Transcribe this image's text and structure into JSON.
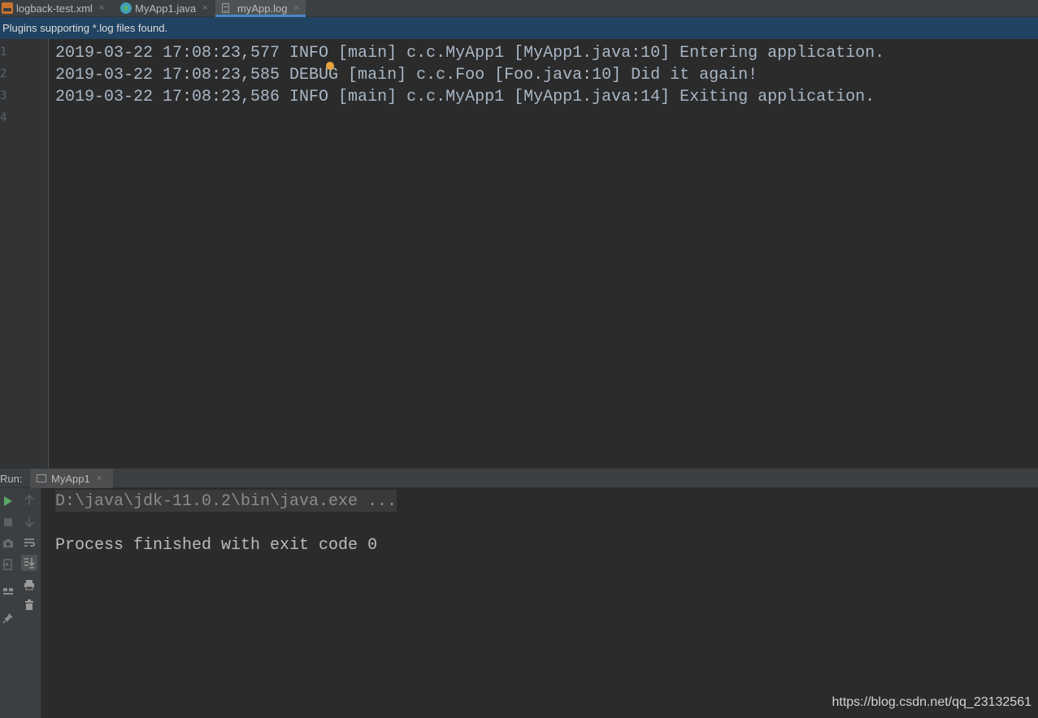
{
  "tabs": [
    {
      "label": "logback-test.xml",
      "icon": "xml-file-icon",
      "active": false
    },
    {
      "label": "MyApp1.java",
      "icon": "java-class-icon",
      "active": false
    },
    {
      "label": "myApp.log",
      "icon": "log-file-icon",
      "active": true
    }
  ],
  "tab_close_glyph": "×",
  "banner": {
    "text": "Plugins supporting *.log files found."
  },
  "editor": {
    "line_numbers": [
      "1",
      "2",
      "3",
      "4"
    ],
    "lines": [
      "2019-03-22 17:08:23,577 INFO [main] c.c.MyApp1 [MyApp1.java:10] Entering application.",
      "2019-03-22 17:08:23,585 DEBUG [main] c.c.Foo [Foo.java:10] Did it again!",
      "2019-03-22 17:08:23,586 INFO [main] c.c.MyApp1 [MyApp1.java:14] Exiting application.",
      ""
    ]
  },
  "run_panel": {
    "label": "Run:",
    "tab_label": "MyApp1",
    "console": {
      "command": "D:\\java\\jdk-11.0.2\\bin\\java.exe ...",
      "blank": "",
      "result": "Process finished with exit code 0"
    }
  },
  "watermark": "https://blog.csdn.net/qq_23132561",
  "colors": {
    "background": "#2b2b2b",
    "gutter": "#313335",
    "banner": "#214362",
    "accent": "#4a88c7",
    "run_green": "#59a869",
    "text": "#a9b7c6"
  }
}
